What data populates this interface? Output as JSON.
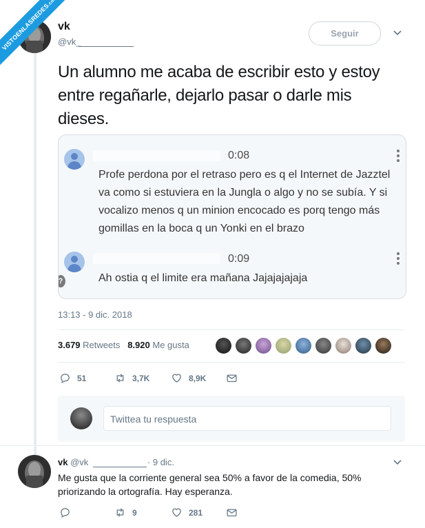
{
  "watermark": {
    "text": "VISTOENLASREDES",
    "suffix": ".com"
  },
  "tweet": {
    "name": "vk",
    "handle": "@vk_",
    "follow_label": "Seguir",
    "text": "Un alumno me acaba de escribir esto y estoy entre regañarle, dejarlo pasar o darle mis dieses.",
    "timestamp": "13:13 - 9 dic. 2018",
    "retweets_count": "3.679",
    "retweets_label": "Retweets",
    "likes_count": "8.920",
    "likes_label": "Me gusta",
    "actions": {
      "replies": "51",
      "retweets": "3,7K",
      "likes": "8,9K"
    }
  },
  "quoted_messages": [
    {
      "time": "0:08",
      "text": "Profe perdona por el retraso pero es q el Internet de Jazztel va como si estuviera en la Jungla o algo y no se subía. Y si vocalizo menos q un minion encocado es porq tengo más gomillas en la boca q un Yonki en el brazo"
    },
    {
      "time": "0:09",
      "text": "Ah ostia q el limite era mañana Jajajajajaja"
    }
  ],
  "quote_badge": "?",
  "reply_box": {
    "placeholder": "Twittea tu respuesta"
  },
  "reply_tweet": {
    "name": "vk",
    "handle": "@vk",
    "date": "· 9 dic.",
    "text": "Me gusta que la corriente general sea 50% a favor de la comedia, 50% priorizando la ortografía. Hay esperanza.",
    "actions": {
      "retweets": "9",
      "likes": "281"
    }
  },
  "colors": {
    "accent": "#1c9be0",
    "muted": "#657786",
    "border": "#e6ecf0"
  },
  "icons": [
    "reply-icon",
    "retweet-icon",
    "heart-icon",
    "message-icon",
    "chevron-down-icon"
  ]
}
